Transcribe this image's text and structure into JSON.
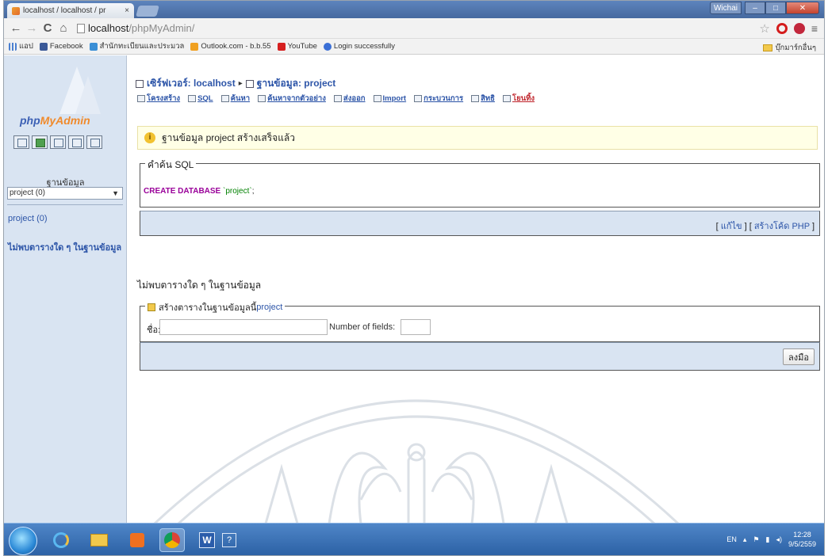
{
  "browser": {
    "tab_title": "localhost / localhost / pr",
    "tab_close": "×",
    "url_host": "localhost",
    "url_path": "/phpMyAdmin/",
    "back": "←",
    "forward": "→",
    "reload": "C",
    "home": "⌂",
    "star": "☆",
    "menu": "≡",
    "window_user": "Wichai"
  },
  "bookmarks": {
    "items": [
      {
        "label": "แอป",
        "icon": "apps-icon"
      },
      {
        "label": "Facebook",
        "icon": "facebook-icon",
        "color": "#3b5998"
      },
      {
        "label": "สำนักทะเบียนและประมวล",
        "icon": "site-icon",
        "color": "#3a8fd6"
      },
      {
        "label": "Outlook.com - b.b.55",
        "icon": "outlook-icon",
        "color": "#f0a020"
      },
      {
        "label": "YouTube",
        "icon": "youtube-icon",
        "color": "#d62020"
      },
      {
        "label": "Login successfully",
        "icon": "login-icon",
        "color": "#3a6fd6"
      }
    ],
    "other": "บุ๊กมาร์กอื่นๆ"
  },
  "sidebar": {
    "logo_php": "php",
    "logo_myadmin": "MyAdmin",
    "db_label": "ฐานข้อมูล",
    "db_select_value": "project (0)",
    "db_link": "project (0)",
    "no_tables": "ไม่พบตารางใด ๆ ในฐานข้อมูล"
  },
  "main": {
    "crumb_server": "เซิร์ฟเวอร์: localhost",
    "crumb_sep": "▸",
    "crumb_db": "ฐานข้อมูล: project",
    "tabs": [
      {
        "label": "โครงสร้าง"
      },
      {
        "label": "SQL"
      },
      {
        "label": "ค้นหา"
      },
      {
        "label": "ค้นหาจากตัวอย่าง"
      },
      {
        "label": "ส่งออก"
      },
      {
        "label": "Import"
      },
      {
        "label": "กระบวนการ"
      },
      {
        "label": "สิทธิ"
      },
      {
        "label": "โยนทิ้ง"
      }
    ],
    "notice": "ฐานข้อมูล project สร้างเสร็จแล้ว",
    "sql_legend": "คำค้น SQL",
    "sql_keyword": "CREATE DATABASE",
    "sql_value": "`project`",
    "sql_end": ";",
    "edit_link": "แก้ไข",
    "php_link": "สร้างโค้ด PHP",
    "no_tables": "ไม่พบตารางใด ๆ ในฐานข้อมูล",
    "create_legend": "สร้างตารางในฐานข้อมูลนี้",
    "create_db": "project",
    "name_label": "ชื่อ:",
    "name_value": "",
    "fields_label": "Number of fields:",
    "fields_value": "",
    "go_button": "ลงมือ"
  },
  "taskbar": {
    "word": "W",
    "help": "?",
    "lang": "EN",
    "time": "12:28",
    "date": "9/5/2559"
  }
}
